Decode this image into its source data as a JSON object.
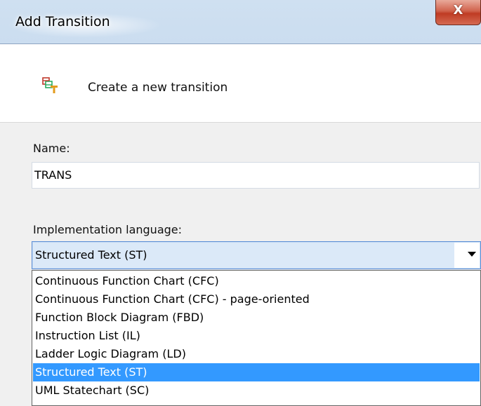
{
  "window": {
    "title": "Add Transition",
    "close_label": "X"
  },
  "header": {
    "icon": "transition-icon",
    "text": "Create a new transition"
  },
  "form": {
    "name_label": "Name:",
    "name_value": "TRANS",
    "language_label": "Implementation language:",
    "language_selected": "Structured Text (ST)",
    "language_options": [
      "Continuous Function Chart (CFC)",
      "Continuous Function Chart (CFC) - page-oriented",
      "Function Block Diagram (FBD)",
      "Instruction List (IL)",
      "Ladder Logic Diagram (LD)",
      "Structured Text (ST)",
      "UML Statechart (SC)"
    ],
    "highlighted_option_index": 5
  },
  "colors": {
    "selection": "#3399ff",
    "close_button": "#c94a33"
  }
}
